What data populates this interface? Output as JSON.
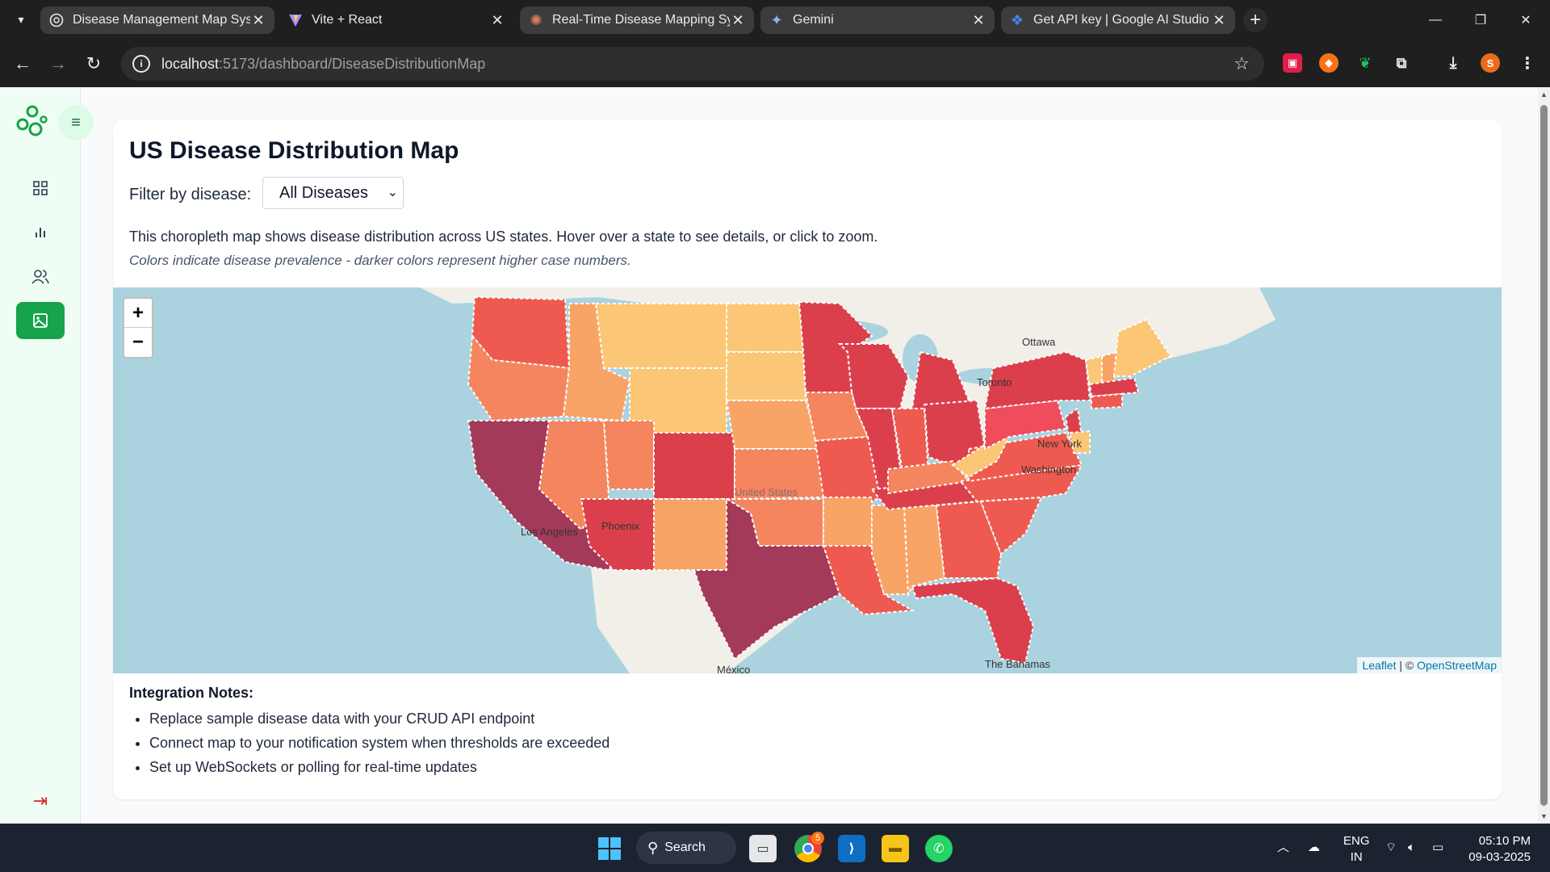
{
  "browser": {
    "tabs": [
      {
        "title": "Disease Management Map Syst",
        "icon": "globe-icon"
      },
      {
        "title": "Vite + React",
        "icon": "vite-icon"
      },
      {
        "title": "Real-Time Disease Mapping Sys",
        "icon": "claude-icon"
      },
      {
        "title": "Gemini",
        "icon": "gemini-icon"
      },
      {
        "title": "Get API key | Google AI Studio",
        "icon": "ai-studio-icon"
      }
    ],
    "url_host": "localhost",
    "url_path": ":5173/dashboard/DiseaseDistributionMap",
    "profile_initial": "S"
  },
  "page": {
    "title": "US Disease Distribution Map",
    "filter_label": "Filter by disease:",
    "filter_value": "All Diseases",
    "description": "This choropleth map shows disease distribution across US states. Hover over a state to see details, or click to zoom.",
    "description_note": "Colors indicate disease prevalence - darker colors represent higher case numbers.",
    "map": {
      "zoom_in": "+",
      "zoom_out": "−",
      "attribution_leaflet": "Leaflet",
      "attribution_sep": " | © ",
      "attribution_osm": "OpenStreetMap",
      "labels": {
        "ottawa": "Ottawa",
        "toronto": "Toronto",
        "new_york": "New York",
        "washington": "Washington",
        "united_states": "United States",
        "phoenix": "Phoenix",
        "los_angeles": "Los Angeles",
        "mexico": "México",
        "bahamas": "The Bahamas"
      },
      "colors": {
        "very_high": "#a33a5a",
        "high": "#dc3f4c",
        "mid_high": "#ee5a4f",
        "mid": "#f5855e",
        "mid_low": "#f8a467",
        "low": "#fbc675"
      }
    },
    "notes": {
      "title": "Integration Notes:",
      "items": [
        "Replace sample disease data with your CRUD API endpoint",
        "Connect map to your notification system when thresholds are exceeded",
        "Set up WebSockets or polling for real-time updates"
      ]
    }
  },
  "taskbar": {
    "search_label": "Search",
    "chrome_badge": "5",
    "lang_top": "ENG",
    "lang_bottom": "IN",
    "time": "05:10 PM",
    "date": "09-03-2025"
  }
}
